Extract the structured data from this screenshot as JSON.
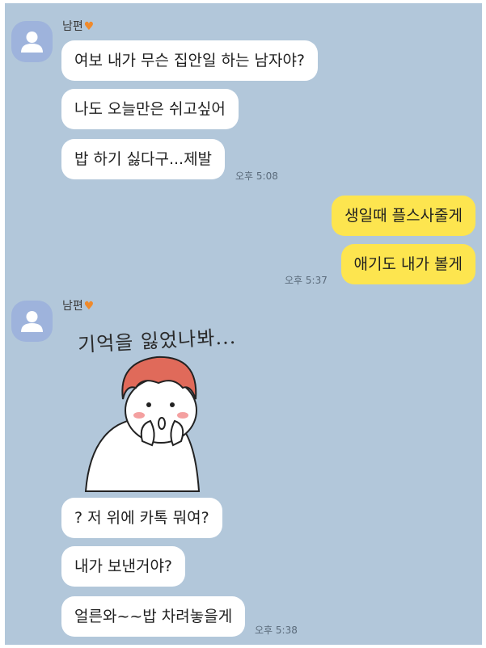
{
  "group1": {
    "sender": "남편",
    "messages": [
      "여보 내가 무슨 집안일 하는 남자야?",
      "나도 오늘만은 쉬고싶어",
      "밥 하기 싫다구...제발"
    ],
    "time": "오후 5:08"
  },
  "group2": {
    "messages": [
      "생일때 플스사줄게",
      "애기도 내가 볼게"
    ],
    "time": "오후 5:37"
  },
  "group3": {
    "sender": "남편",
    "sticker_text": "기억을 잃었나봐...",
    "messages": [
      "? 저 위에 카톡 뭐여?",
      "내가 보낸거야?",
      "얼른와~~밥 차려놓을게"
    ],
    "time": "오후 5:38"
  },
  "icons": {
    "avatar": "default-profile-icon",
    "heart": "orange-heart-emoji",
    "sticker": "surprised-character-sticker"
  },
  "colors": {
    "chat_background": "#b2c7da",
    "incoming_bubble": "#ffffff",
    "outgoing_bubble": "#fde54f",
    "avatar": "#9eb3dc"
  }
}
